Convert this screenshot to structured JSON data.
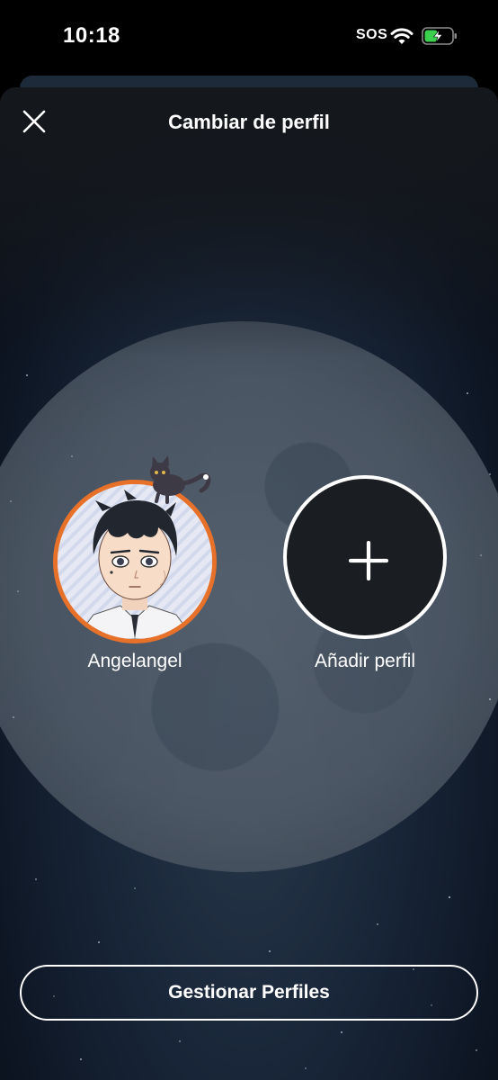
{
  "status_bar": {
    "time": "10:18",
    "sos": "SOS",
    "wifi_icon": "wifi-icon",
    "battery_icon": "battery-charging-icon",
    "battery_color": "#3ccf4e"
  },
  "header": {
    "title": "Cambiar de perfil",
    "close_icon": "close-icon"
  },
  "profiles": [
    {
      "name": "Angelangel",
      "ring_color": "#e8712a"
    }
  ],
  "add_profile": {
    "label": "Añadir perfil",
    "icon": "plus-icon"
  },
  "manage_button": {
    "label": "Gestionar Perfiles"
  }
}
